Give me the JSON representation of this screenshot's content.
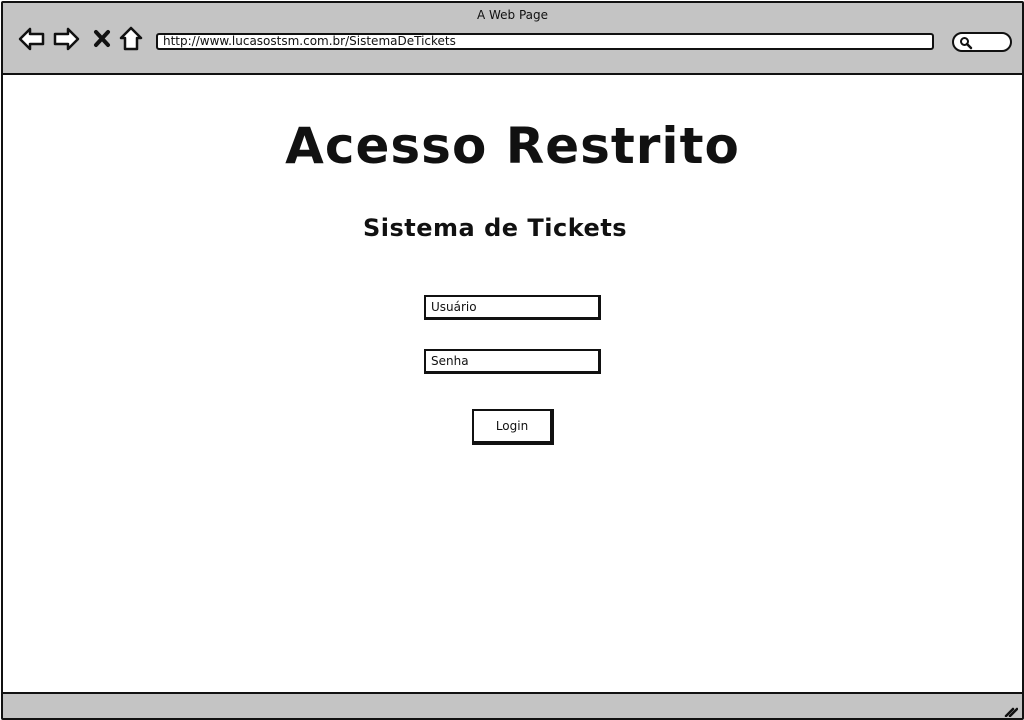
{
  "window": {
    "title": "A Web Page"
  },
  "toolbar": {
    "back_icon": "arrow-left-icon",
    "forward_icon": "arrow-right-icon",
    "stop_icon": "close-icon",
    "home_icon": "home-icon",
    "url": "http://www.lucasostsm.com.br/SistemaDeTickets",
    "search_icon": "search-icon"
  },
  "page": {
    "title": "Acesso Restrito",
    "subtitle": "Sistema de Tickets",
    "username_placeholder": "Usuário",
    "password_placeholder": "Senha",
    "login_label": "Login"
  },
  "colors": {
    "chrome": "#c4c4c4",
    "ink": "#111111",
    "background": "#ffffff"
  }
}
